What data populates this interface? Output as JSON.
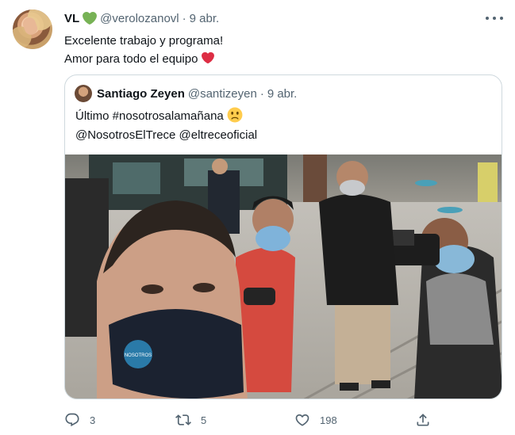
{
  "tweet": {
    "author_name": "VL",
    "author_handle": "@verolozanovl",
    "separator": "·",
    "date": "9 abr.",
    "text_line_1": "Excelente trabajo y programa!",
    "text_line_2": "Amor para todo el equipo",
    "icons": {
      "verified_heart": "green-heart-icon",
      "more": "more-icon",
      "text_heart": "red-heart-icon"
    },
    "colors": {
      "green_heart": "#77b255",
      "red_heart": "#dd2e44",
      "muted": "#536471",
      "border": "#cfd9de"
    }
  },
  "quoted": {
    "author_name": "Santiago Zeyen",
    "author_handle": "@santizeyen",
    "separator": "·",
    "date": "9 abr.",
    "text_line_1": "Último #nosotrosalamañana",
    "text_line_2": "@NosotrosElTrece @eltreceoficial",
    "mask_logo_text": "NOSOTROS"
  },
  "actions": {
    "reply_count": "3",
    "retweet_count": "5",
    "like_count": "198"
  }
}
